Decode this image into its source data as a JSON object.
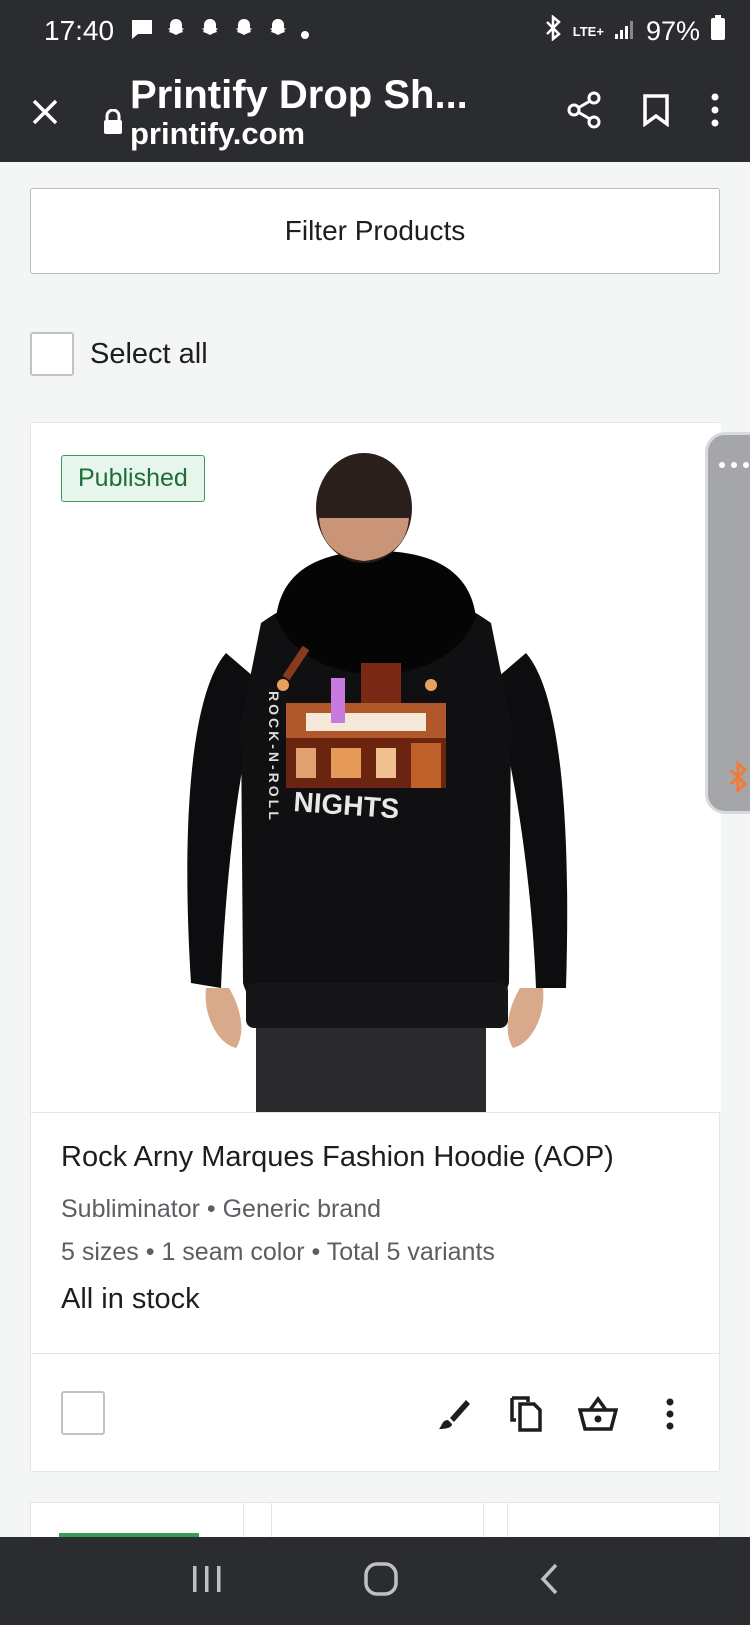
{
  "status": {
    "time": "17:40",
    "network": "LTE+",
    "battery": "97%"
  },
  "browser": {
    "title": "Printify Drop Sh...",
    "url": "printify.com"
  },
  "filter": {
    "label": "Filter Products"
  },
  "select_all": {
    "label": "Select all"
  },
  "product": {
    "badge": "Published",
    "name": "Rock Arny Marques Fashion Hoodie (AOP)",
    "brand_line": "Subliminator • Generic brand",
    "variants_line": "5 sizes • 1 seam color • Total 5 variants",
    "stock": "All in stock",
    "graphic_text_1": "ROCK-N-ROLL",
    "graphic_text_2": "NIGHTS"
  },
  "colors": {
    "dark_bar": "#2b2c2f",
    "published_green": "#3a9a5a"
  }
}
